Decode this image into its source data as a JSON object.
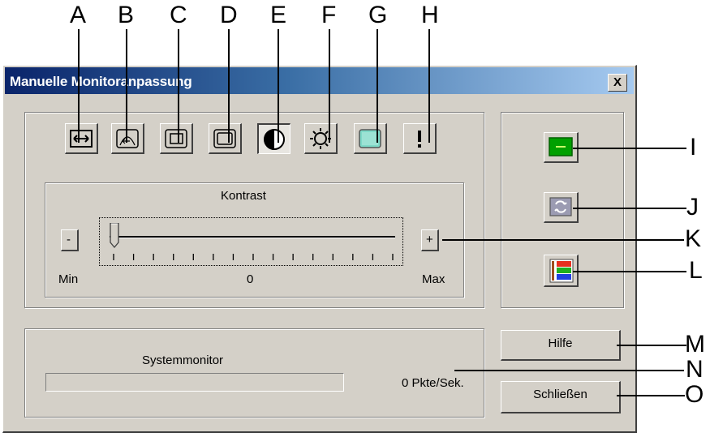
{
  "window": {
    "title": "Manuelle Monitoranpassung",
    "close_label": "X"
  },
  "toolbar": {
    "items": [
      {
        "name": "width-icon"
      },
      {
        "name": "position-icon"
      },
      {
        "name": "zoom-icon"
      },
      {
        "name": "size-icon"
      },
      {
        "name": "contrast-icon",
        "selected": true
      },
      {
        "name": "brightness-icon"
      },
      {
        "name": "color-icon"
      },
      {
        "name": "info-icon"
      }
    ]
  },
  "slider": {
    "title": "Kontrast",
    "minus_label": "-",
    "plus_label": "+",
    "min_label": "Min",
    "value_label": "0",
    "max_label": "Max",
    "value_fraction": 0
  },
  "status": {
    "label": "Systemmonitor",
    "rate": "0 Pkte/Sek.",
    "progress_fraction": 0
  },
  "side_buttons": [
    {
      "name": "monitor-setup-icon",
      "color": "#00a000"
    },
    {
      "name": "reset-icon"
    },
    {
      "name": "color-bars-icon"
    }
  ],
  "buttons": {
    "help": "Hilfe",
    "close": "Schließen"
  },
  "callouts": {
    "A": "A",
    "B": "B",
    "C": "C",
    "D": "D",
    "E": "E",
    "F": "F",
    "G": "G",
    "H": "H",
    "I": "I",
    "J": "J",
    "K": "K",
    "L": "L",
    "M": "M",
    "N": "N",
    "O": "O"
  }
}
